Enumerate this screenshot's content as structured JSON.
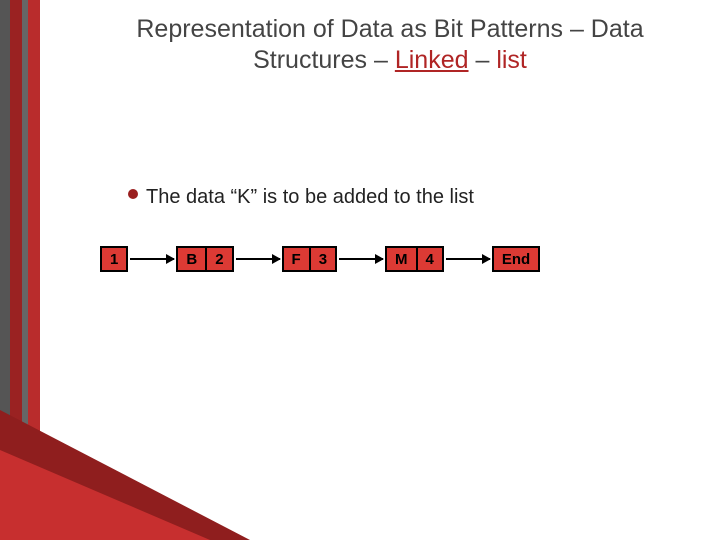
{
  "title": {
    "part1": "Representation of Data as Bit Patterns – Data Structures – ",
    "accent2": "Linked",
    "part2": " – ",
    "accent1": "list"
  },
  "bullet": "The data “K” is to be added to the list",
  "nodes": {
    "start": "1",
    "n1": {
      "data": "B",
      "ptr": "2"
    },
    "n2": {
      "data": "F",
      "ptr": "3"
    },
    "n3": {
      "data": "M",
      "ptr": "4"
    },
    "end": "End"
  }
}
